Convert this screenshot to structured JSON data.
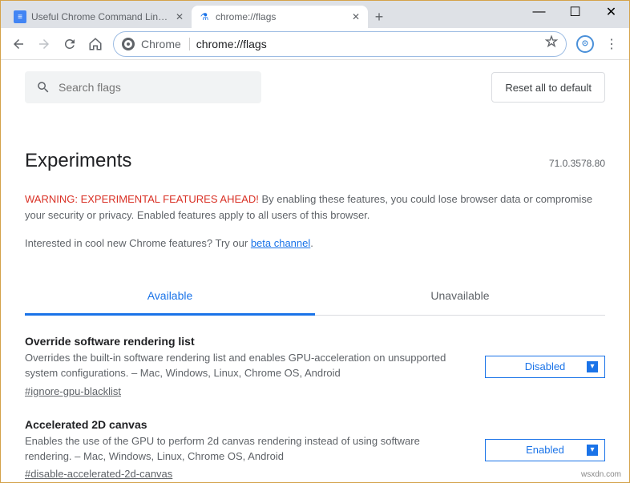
{
  "tabs": [
    {
      "title": "Useful Chrome Command Line S",
      "active": false
    },
    {
      "title": "chrome://flags",
      "active": true
    }
  ],
  "toolbar": {
    "security_label": "Chrome",
    "url": "chrome://flags"
  },
  "search": {
    "placeholder": "Search flags"
  },
  "reset_label": "Reset all to default",
  "heading": "Experiments",
  "version": "71.0.3578.80",
  "warning": {
    "prefix": "WARNING: EXPERIMENTAL FEATURES AHEAD!",
    "body": " By enabling these features, you could lose browser data or compromise your security or privacy. Enabled features apply to all users of this browser."
  },
  "beta": {
    "text": "Interested in cool new Chrome features? Try our ",
    "link": "beta channel",
    "suffix": "."
  },
  "flag_tabs": {
    "available": "Available",
    "unavailable": "Unavailable"
  },
  "flags": [
    {
      "title": "Override software rendering list",
      "desc": "Overrides the built-in software rendering list and enables GPU-acceleration on unsupported system configurations. – Mac, Windows, Linux, Chrome OS, Android",
      "anchor": "#ignore-gpu-blacklist",
      "state": "Disabled"
    },
    {
      "title": "Accelerated 2D canvas",
      "desc": "Enables the use of the GPU to perform 2d canvas rendering instead of using software rendering. – Mac, Windows, Linux, Chrome OS, Android",
      "anchor": "#disable-accelerated-2d-canvas",
      "state": "Enabled"
    }
  ],
  "watermark": "wsxdn.com"
}
